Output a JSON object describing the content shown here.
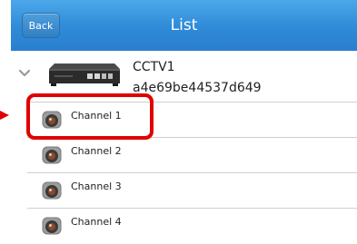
{
  "header": {
    "back_label": "Back",
    "title": "List"
  },
  "device": {
    "name": "CCTV1",
    "id": "a4e69be44537d649",
    "icon": "dvr-recorder-icon",
    "expanded": true
  },
  "channels": [
    {
      "label": "Channel 1",
      "icon": "camera-icon",
      "highlighted": true
    },
    {
      "label": "Channel 2",
      "icon": "camera-icon"
    },
    {
      "label": "Channel 3",
      "icon": "camera-icon"
    },
    {
      "label": "Channel 4",
      "icon": "camera-icon"
    }
  ],
  "colors": {
    "navbar": "#2f8ad8",
    "highlight": "#e00000",
    "divider": "#cfcfcf"
  }
}
